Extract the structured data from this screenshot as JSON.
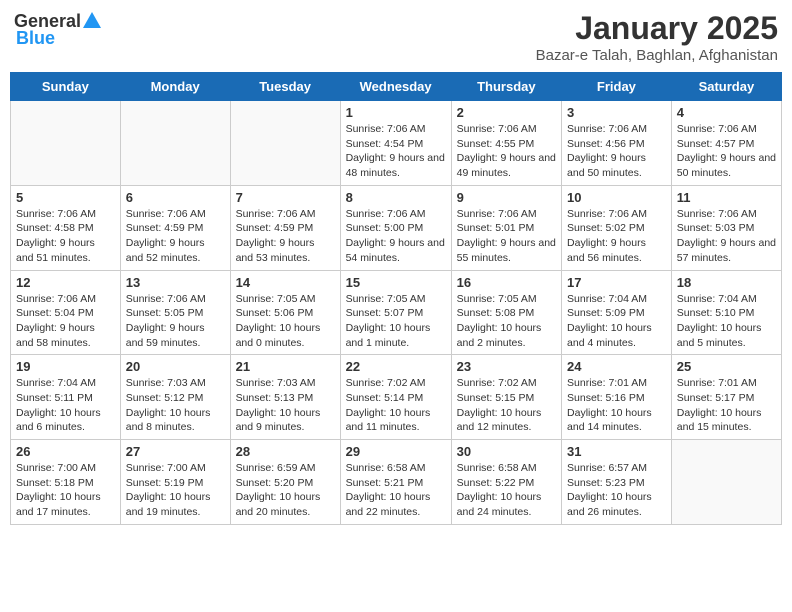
{
  "header": {
    "logo_general": "General",
    "logo_blue": "Blue",
    "title": "January 2025",
    "subtitle": "Bazar-e Talah, Baghlan, Afghanistan"
  },
  "weekdays": [
    "Sunday",
    "Monday",
    "Tuesday",
    "Wednesday",
    "Thursday",
    "Friday",
    "Saturday"
  ],
  "weeks": [
    [
      {
        "date": "",
        "info": ""
      },
      {
        "date": "",
        "info": ""
      },
      {
        "date": "",
        "info": ""
      },
      {
        "date": "1",
        "info": "Sunrise: 7:06 AM\nSunset: 4:54 PM\nDaylight: 9 hours and 48 minutes."
      },
      {
        "date": "2",
        "info": "Sunrise: 7:06 AM\nSunset: 4:55 PM\nDaylight: 9 hours and 49 minutes."
      },
      {
        "date": "3",
        "info": "Sunrise: 7:06 AM\nSunset: 4:56 PM\nDaylight: 9 hours and 50 minutes."
      },
      {
        "date": "4",
        "info": "Sunrise: 7:06 AM\nSunset: 4:57 PM\nDaylight: 9 hours and 50 minutes."
      }
    ],
    [
      {
        "date": "5",
        "info": "Sunrise: 7:06 AM\nSunset: 4:58 PM\nDaylight: 9 hours and 51 minutes."
      },
      {
        "date": "6",
        "info": "Sunrise: 7:06 AM\nSunset: 4:59 PM\nDaylight: 9 hours and 52 minutes."
      },
      {
        "date": "7",
        "info": "Sunrise: 7:06 AM\nSunset: 4:59 PM\nDaylight: 9 hours and 53 minutes."
      },
      {
        "date": "8",
        "info": "Sunrise: 7:06 AM\nSunset: 5:00 PM\nDaylight: 9 hours and 54 minutes."
      },
      {
        "date": "9",
        "info": "Sunrise: 7:06 AM\nSunset: 5:01 PM\nDaylight: 9 hours and 55 minutes."
      },
      {
        "date": "10",
        "info": "Sunrise: 7:06 AM\nSunset: 5:02 PM\nDaylight: 9 hours and 56 minutes."
      },
      {
        "date": "11",
        "info": "Sunrise: 7:06 AM\nSunset: 5:03 PM\nDaylight: 9 hours and 57 minutes."
      }
    ],
    [
      {
        "date": "12",
        "info": "Sunrise: 7:06 AM\nSunset: 5:04 PM\nDaylight: 9 hours and 58 minutes."
      },
      {
        "date": "13",
        "info": "Sunrise: 7:06 AM\nSunset: 5:05 PM\nDaylight: 9 hours and 59 minutes."
      },
      {
        "date": "14",
        "info": "Sunrise: 7:05 AM\nSunset: 5:06 PM\nDaylight: 10 hours and 0 minutes."
      },
      {
        "date": "15",
        "info": "Sunrise: 7:05 AM\nSunset: 5:07 PM\nDaylight: 10 hours and 1 minute."
      },
      {
        "date": "16",
        "info": "Sunrise: 7:05 AM\nSunset: 5:08 PM\nDaylight: 10 hours and 2 minutes."
      },
      {
        "date": "17",
        "info": "Sunrise: 7:04 AM\nSunset: 5:09 PM\nDaylight: 10 hours and 4 minutes."
      },
      {
        "date": "18",
        "info": "Sunrise: 7:04 AM\nSunset: 5:10 PM\nDaylight: 10 hours and 5 minutes."
      }
    ],
    [
      {
        "date": "19",
        "info": "Sunrise: 7:04 AM\nSunset: 5:11 PM\nDaylight: 10 hours and 6 minutes."
      },
      {
        "date": "20",
        "info": "Sunrise: 7:03 AM\nSunset: 5:12 PM\nDaylight: 10 hours and 8 minutes."
      },
      {
        "date": "21",
        "info": "Sunrise: 7:03 AM\nSunset: 5:13 PM\nDaylight: 10 hours and 9 minutes."
      },
      {
        "date": "22",
        "info": "Sunrise: 7:02 AM\nSunset: 5:14 PM\nDaylight: 10 hours and 11 minutes."
      },
      {
        "date": "23",
        "info": "Sunrise: 7:02 AM\nSunset: 5:15 PM\nDaylight: 10 hours and 12 minutes."
      },
      {
        "date": "24",
        "info": "Sunrise: 7:01 AM\nSunset: 5:16 PM\nDaylight: 10 hours and 14 minutes."
      },
      {
        "date": "25",
        "info": "Sunrise: 7:01 AM\nSunset: 5:17 PM\nDaylight: 10 hours and 15 minutes."
      }
    ],
    [
      {
        "date": "26",
        "info": "Sunrise: 7:00 AM\nSunset: 5:18 PM\nDaylight: 10 hours and 17 minutes."
      },
      {
        "date": "27",
        "info": "Sunrise: 7:00 AM\nSunset: 5:19 PM\nDaylight: 10 hours and 19 minutes."
      },
      {
        "date": "28",
        "info": "Sunrise: 6:59 AM\nSunset: 5:20 PM\nDaylight: 10 hours and 20 minutes."
      },
      {
        "date": "29",
        "info": "Sunrise: 6:58 AM\nSunset: 5:21 PM\nDaylight: 10 hours and 22 minutes."
      },
      {
        "date": "30",
        "info": "Sunrise: 6:58 AM\nSunset: 5:22 PM\nDaylight: 10 hours and 24 minutes."
      },
      {
        "date": "31",
        "info": "Sunrise: 6:57 AM\nSunset: 5:23 PM\nDaylight: 10 hours and 26 minutes."
      },
      {
        "date": "",
        "info": ""
      }
    ]
  ]
}
